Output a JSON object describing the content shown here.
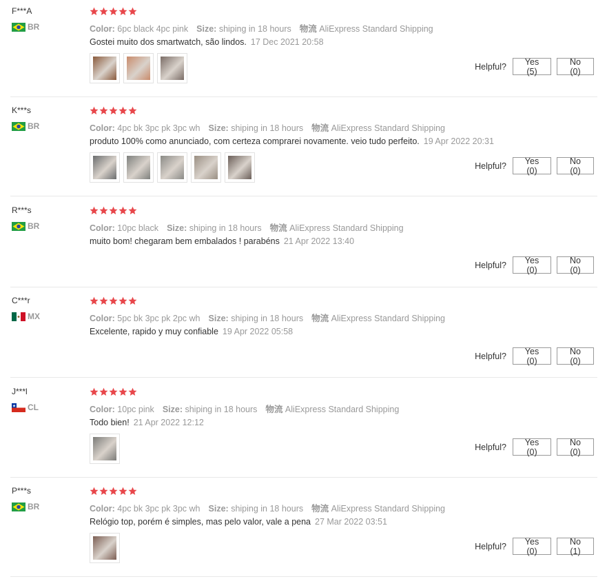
{
  "labels": {
    "color": "Color:",
    "size": "Size:",
    "logistics": "物流",
    "helpful": "Helpful?"
  },
  "colors": {
    "star": "#e8474b",
    "text": "#333333",
    "muted": "#999999"
  },
  "reviews": [
    {
      "user": "F***A",
      "country": "BR",
      "flag": "brazil",
      "rating": 5,
      "color": "6pc black 4pc pink",
      "size": "shiping in 18 hours",
      "logistics": "AliExpress Standard Shipping",
      "text": "Gostei muito dos smartwatch, são lindos.",
      "date": "17 Dec 2021 20:58",
      "photos": [
        "product-photo",
        "product-photo",
        "product-photo"
      ],
      "yes": "Yes (5)",
      "no": "No (0)"
    },
    {
      "user": "K***s",
      "country": "BR",
      "flag": "brazil",
      "rating": 5,
      "color": "4pc bk 3pc pk 3pc wh",
      "size": "shiping in 18 hours",
      "logistics": "AliExpress Standard Shipping",
      "text": "produto 100% como anunciado, com certeza comprarei novamente. veio tudo perfeito.",
      "date": "19 Apr 2022 20:31",
      "photos": [
        "product-photo",
        "product-photo",
        "product-photo",
        "product-photo",
        "product-photo"
      ],
      "yes": "Yes (0)",
      "no": "No (0)"
    },
    {
      "user": "R***s",
      "country": "BR",
      "flag": "brazil",
      "rating": 5,
      "color": "10pc black",
      "size": "shiping in 18 hours",
      "logistics": "AliExpress Standard Shipping",
      "text": "muito bom! chegaram bem embalados ! parabéns",
      "date": "21 Apr 2022 13:40",
      "photos": [],
      "yes": "Yes (0)",
      "no": "No (0)"
    },
    {
      "user": "C***r",
      "country": "MX",
      "flag": "mexico",
      "rating": 5,
      "color": "5pc bk 3pc pk 2pc wh",
      "size": "shiping in 18 hours",
      "logistics": "AliExpress Standard Shipping",
      "text": "Excelente, rapido y muy confiable",
      "date": "19 Apr 2022 05:58",
      "photos": [],
      "yes": "Yes (0)",
      "no": "No (0)"
    },
    {
      "user": "J***l",
      "country": "CL",
      "flag": "chile",
      "rating": 5,
      "color": "10pc pink",
      "size": "shiping in 18 hours",
      "logistics": "AliExpress Standard Shipping",
      "text": "Todo bien!",
      "date": "21 Apr 2022 12:12",
      "photos": [
        "product-photo"
      ],
      "yes": "Yes (0)",
      "no": "No (0)"
    },
    {
      "user": "P***s",
      "country": "BR",
      "flag": "brazil",
      "rating": 5,
      "color": "4pc bk 3pc pk 3pc wh",
      "size": "shiping in 18 hours",
      "logistics": "AliExpress Standard Shipping",
      "text": "Relógio top, porém é simples, mas pelo valor, vale a pena",
      "date": "27 Mar 2022 03:51",
      "photos": [
        "product-photo"
      ],
      "yes": "Yes (0)",
      "no": "No (1)"
    }
  ]
}
